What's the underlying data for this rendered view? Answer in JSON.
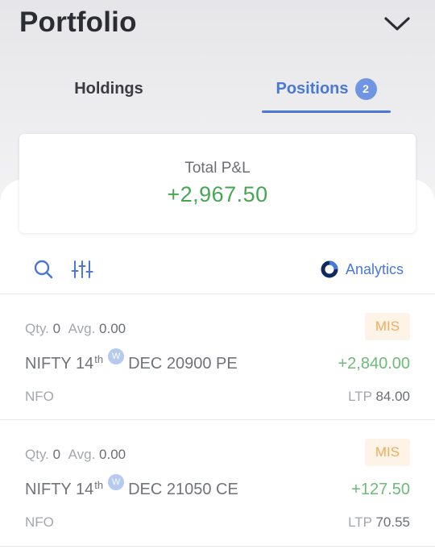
{
  "header": {
    "title": "Portfolio",
    "toggle_icon": "chevron-down-icon"
  },
  "tabs": [
    {
      "label": "Holdings",
      "active": false
    },
    {
      "label": "Positions",
      "active": true,
      "badge": "2"
    }
  ],
  "summary": {
    "label": "Total P&L",
    "value": "+2,967.50"
  },
  "toolbar": {
    "search_icon": "search-icon",
    "filter_icon": "filter-icon",
    "analytics_label": "Analytics"
  },
  "positions": [
    {
      "qty_label": "Qty.",
      "qty": "0",
      "avg_label": "Avg.",
      "avg": "0.00",
      "product": "MIS",
      "symbol": "NIFTY 14",
      "ordinal": "th",
      "weekly": "W",
      "contract": "DEC 20900 PE",
      "pnl": "+2,840.00",
      "exchange": "NFO",
      "ltp_label": "LTP",
      "ltp": "84.00"
    },
    {
      "qty_label": "Qty.",
      "qty": "0",
      "avg_label": "Avg.",
      "avg": "0.00",
      "product": "MIS",
      "symbol": "NIFTY 14",
      "ordinal": "th",
      "weekly": "W",
      "contract": "DEC 21050 CE",
      "pnl": "+127.50",
      "exchange": "NFO",
      "ltp_label": "LTP",
      "ltp": "70.55"
    }
  ],
  "colors": {
    "accent": "#4a78d6",
    "profit": "#47a653",
    "product_badge": "#f0ac5b"
  }
}
